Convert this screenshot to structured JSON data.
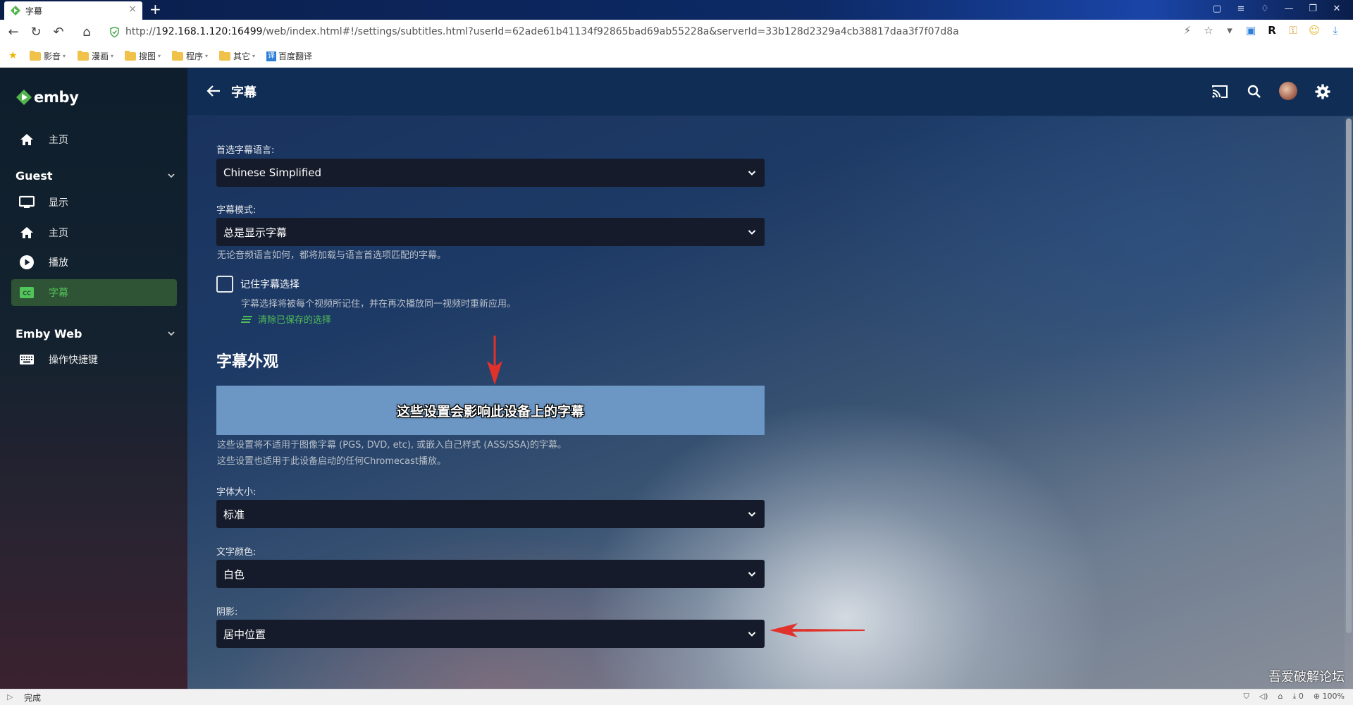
{
  "browser": {
    "tab_title": "字幕",
    "url_prefix": "http://",
    "url_host": "192.168.1.120:16499",
    "url_path": "/web/index.html#!/settings/subtitles.html?userId=62ade61b41134f92865bad69ab55228a&serverId=33b128d2329a4cb38817daa3f7f07d8a",
    "bookmarks": [
      "影音",
      "漫画",
      "搜图",
      "程序",
      "其它",
      "百度翻译"
    ],
    "status_text": "完成",
    "status_right": [
      "0",
      "100%"
    ]
  },
  "sidebar": {
    "logo_text": "emby",
    "home_label": "主页",
    "sections": [
      {
        "title": "Guest",
        "items": [
          "显示",
          "主页",
          "播放",
          "字幕"
        ]
      },
      {
        "title": "Emby Web",
        "items": [
          "操作快捷键"
        ]
      }
    ]
  },
  "header": {
    "title": "字幕"
  },
  "form": {
    "preferred_language_label": "首选字幕语言:",
    "preferred_language_value": "Chinese Simplified",
    "mode_label": "字幕模式:",
    "mode_value": "总是显示字幕",
    "mode_help": "无论音频语言如何，都将加载与语言首选项匹配的字幕。",
    "remember_label": "记住字幕选择",
    "remember_checked": false,
    "remember_help": "字幕选择将被每个视频所记住，并在再次播放同一视频时重新应用。",
    "clear_link": "清除已保存的选择",
    "appearance_title": "字幕外观",
    "preview_text": "这些设置会影响此设备上的字幕",
    "appearance_help1": "这些设置将不适用于图像字幕 (PGS, DVD, etc), 或嵌入自己样式 (ASS/SSA)的字幕。",
    "appearance_help2": "这些设置也适用于此设备启动的任何Chromecast播放。",
    "font_size_label": "字体大小:",
    "font_size_value": "标准",
    "text_color_label": "文字颜色:",
    "text_color_value": "白色",
    "shadow_label": "阴影:",
    "shadow_value": "居中位置"
  },
  "watermark": "吾爱破解论坛",
  "colors": {
    "accent_green": "#52c55a",
    "active_bg": "#2e5435",
    "arrow_red": "#e0312a"
  }
}
